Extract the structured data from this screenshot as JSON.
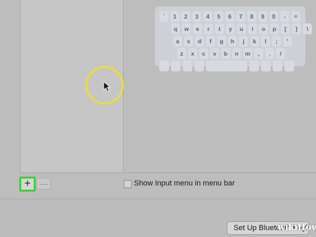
{
  "keyboard": {
    "rows": [
      [
        "`",
        "1",
        "2",
        "3",
        "4",
        "5",
        "6",
        "7",
        "8",
        "9",
        "0",
        "-",
        "="
      ],
      [
        "q",
        "w",
        "e",
        "r",
        "t",
        "y",
        "u",
        "i",
        "o",
        "p",
        "[",
        "]",
        "\\"
      ],
      [
        "a",
        "s",
        "d",
        "f",
        "g",
        "h",
        "j",
        "k",
        "l",
        ";",
        "'"
      ],
      [
        "z",
        "x",
        "c",
        "v",
        "b",
        "n",
        "m",
        ",",
        ".",
        "/"
      ]
    ]
  },
  "bottom_bar": {
    "add_label": "+",
    "remove_label": "—",
    "show_input_menu_label": "Show Input menu in menu bar",
    "show_input_menu_checked": false
  },
  "setup_button": {
    "label": "Set Up Bluetooth Keyboard…"
  },
  "watermark": {
    "text": "wikiHow"
  }
}
